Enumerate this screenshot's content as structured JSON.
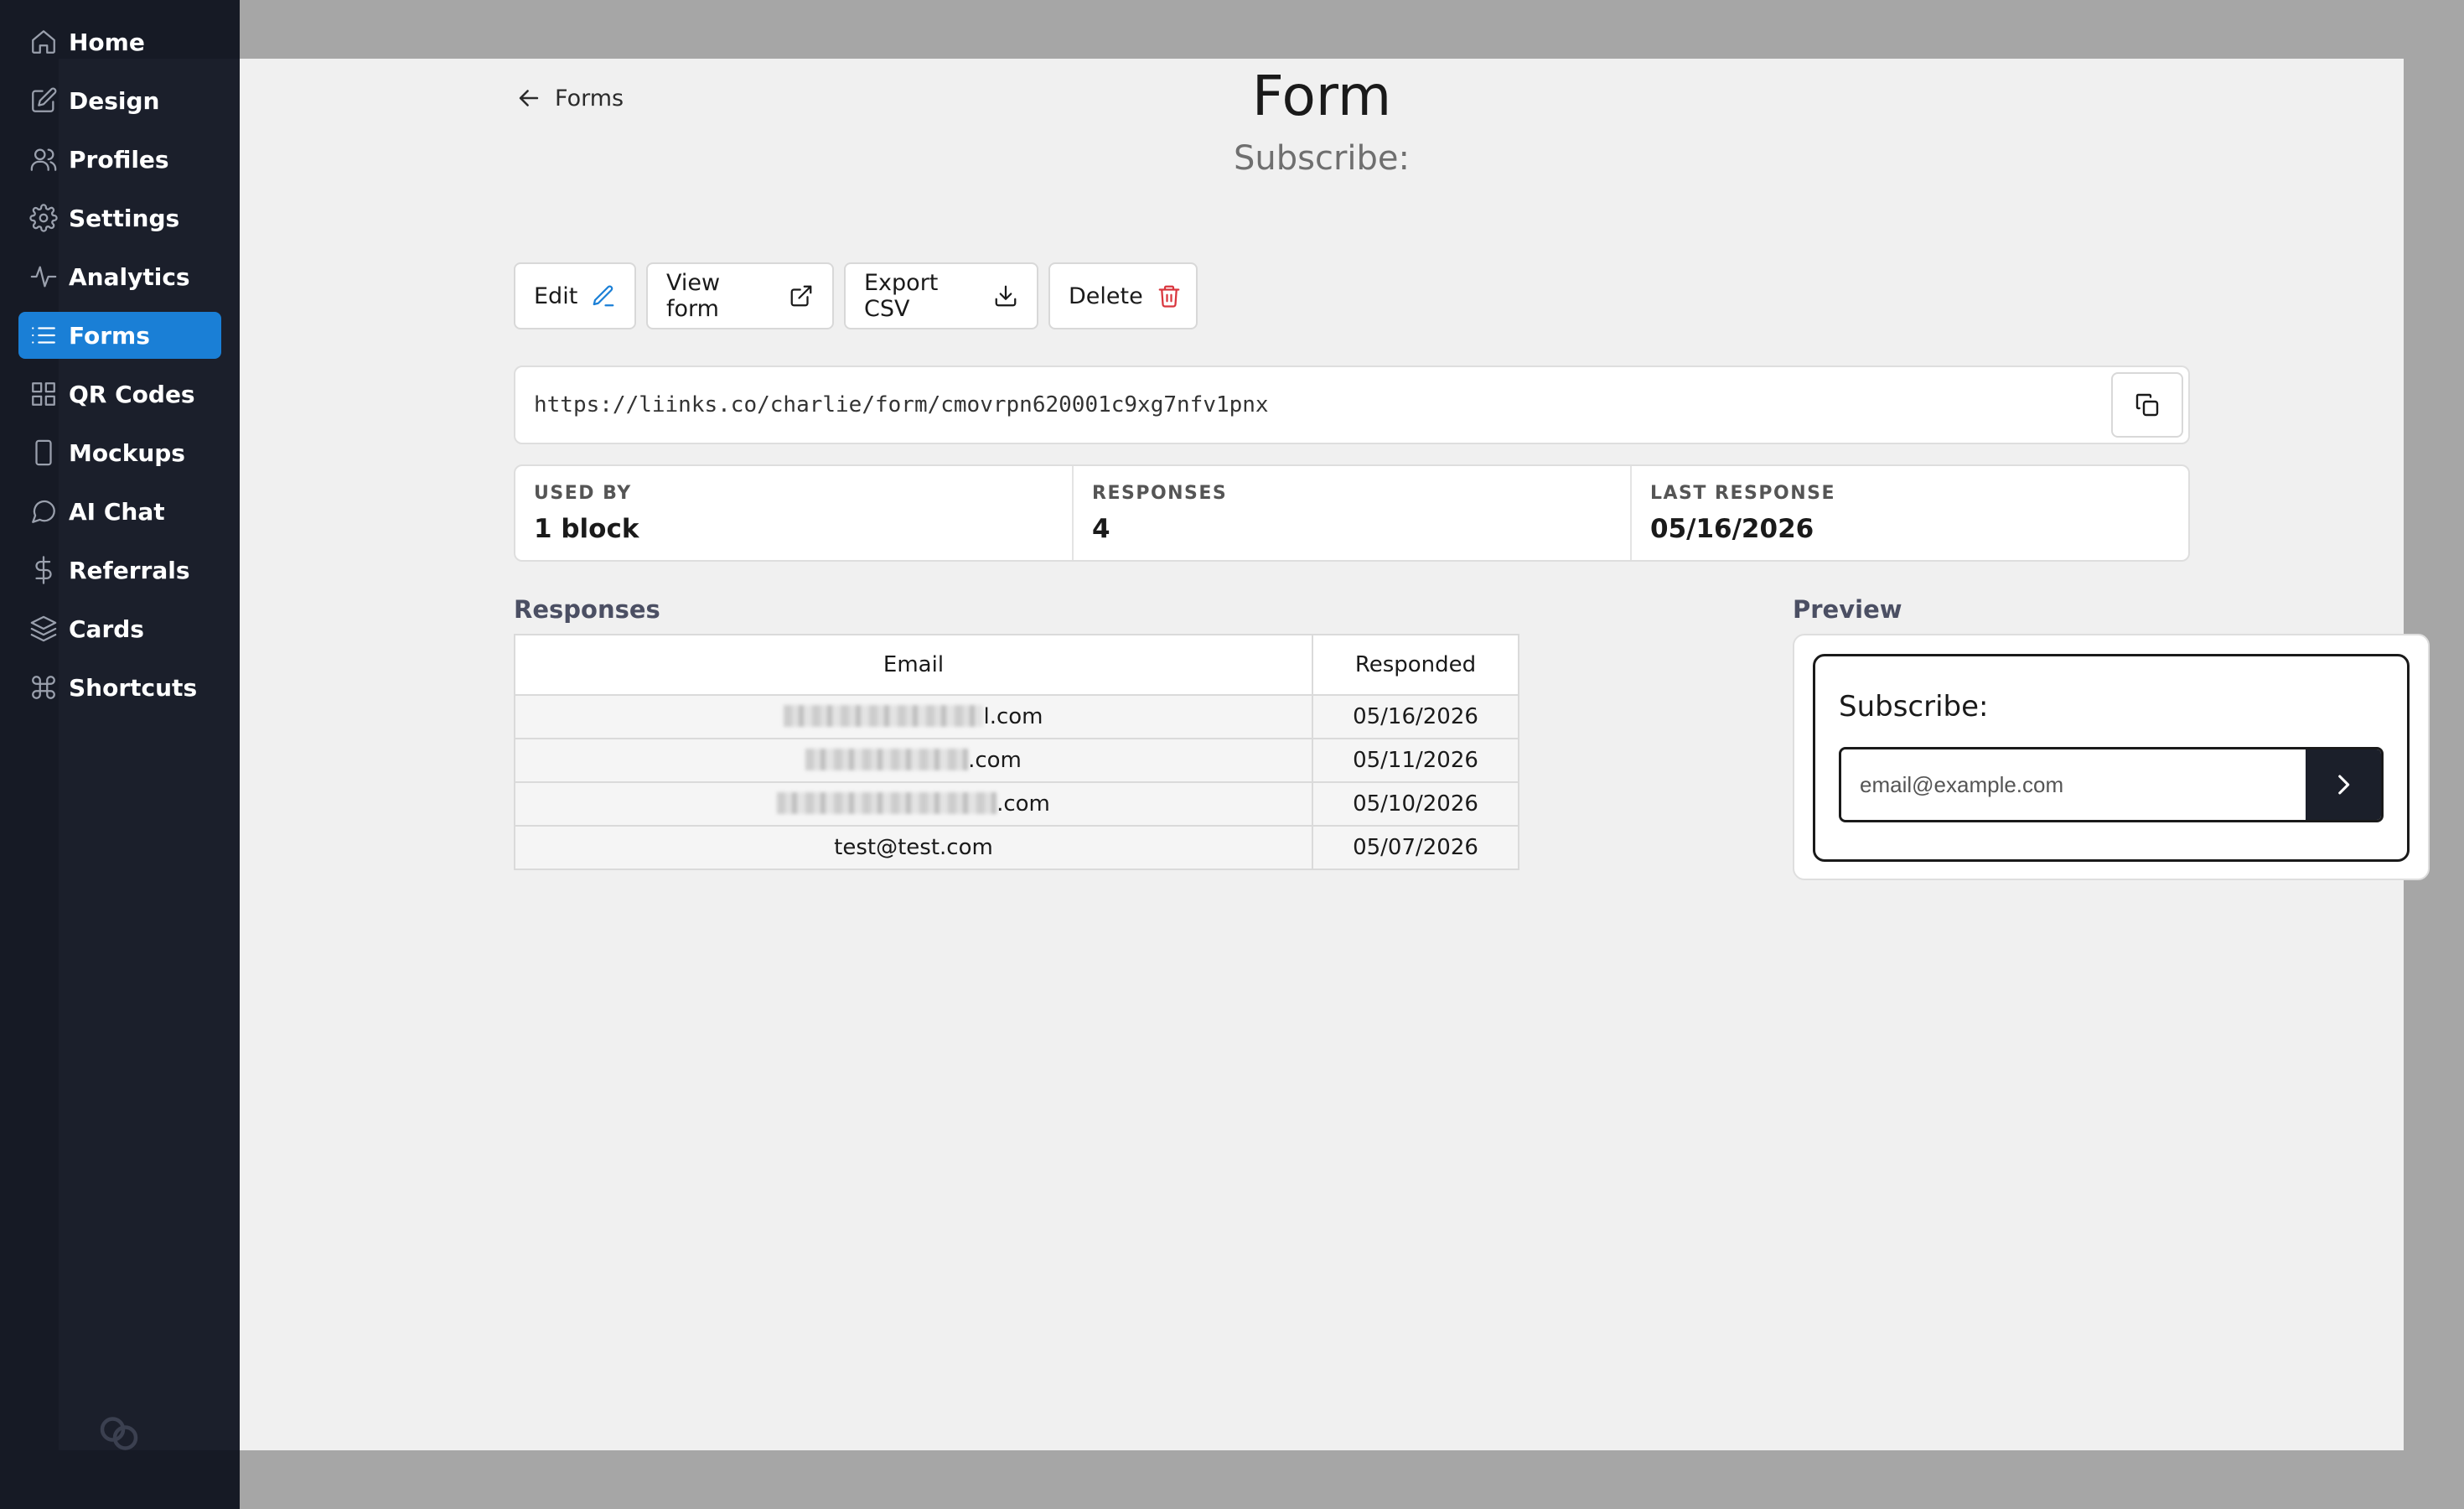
{
  "sidebar": {
    "items": [
      {
        "label": "Home",
        "icon": "home-icon",
        "active": false
      },
      {
        "label": "Design",
        "icon": "edit-square-icon",
        "active": false
      },
      {
        "label": "Profiles",
        "icon": "users-icon",
        "active": false
      },
      {
        "label": "Settings",
        "icon": "gear-icon",
        "active": false
      },
      {
        "label": "Analytics",
        "icon": "activity-icon",
        "active": false
      },
      {
        "label": "Forms",
        "icon": "list-icon",
        "active": true
      },
      {
        "label": "QR Codes",
        "icon": "grid-icon",
        "active": false
      },
      {
        "label": "Mockups",
        "icon": "phone-icon",
        "active": false
      },
      {
        "label": "AI Chat",
        "icon": "chat-bubble-icon",
        "active": false
      },
      {
        "label": "Referrals",
        "icon": "dollar-icon",
        "active": false
      },
      {
        "label": "Cards",
        "icon": "layers-icon",
        "active": false
      },
      {
        "label": "Shortcuts",
        "icon": "command-icon",
        "active": false
      }
    ],
    "accent_color": "#1a7fd6"
  },
  "header": {
    "back_label": "Forms",
    "title": "Form",
    "subtitle": "Subscribe:"
  },
  "toolbar": {
    "edit_label": "Edit",
    "view_form_label": "View form",
    "export_csv_label": "Export CSV",
    "delete_label": "Delete",
    "delete_color": "#d9363e",
    "edit_color": "#1a7fd6"
  },
  "form_url": "https://liinks.co/charlie/form/cmovrpn620001c9xg7nfv1pnx",
  "stats": {
    "used_by_label": "USED BY",
    "used_by_value": "1 block",
    "responses_label": "RESPONSES",
    "responses_value": "4",
    "last_response_label": "LAST RESPONSE",
    "last_response_value": "05/16/2026"
  },
  "responses": {
    "title": "Responses",
    "columns": [
      "Email",
      "Responded"
    ],
    "rows": [
      {
        "email_visible": "l.com",
        "redacted": true,
        "responded": "05/16/2026"
      },
      {
        "email_visible": ".com",
        "redacted": true,
        "responded": "05/11/2026"
      },
      {
        "email_visible": ".com",
        "redacted": true,
        "responded": "05/10/2026"
      },
      {
        "email_visible": "test@test.com",
        "redacted": false,
        "responded": "05/07/2026"
      }
    ]
  },
  "preview": {
    "title": "Preview",
    "heading": "Subscribe:",
    "input_placeholder": "email@example.com"
  }
}
